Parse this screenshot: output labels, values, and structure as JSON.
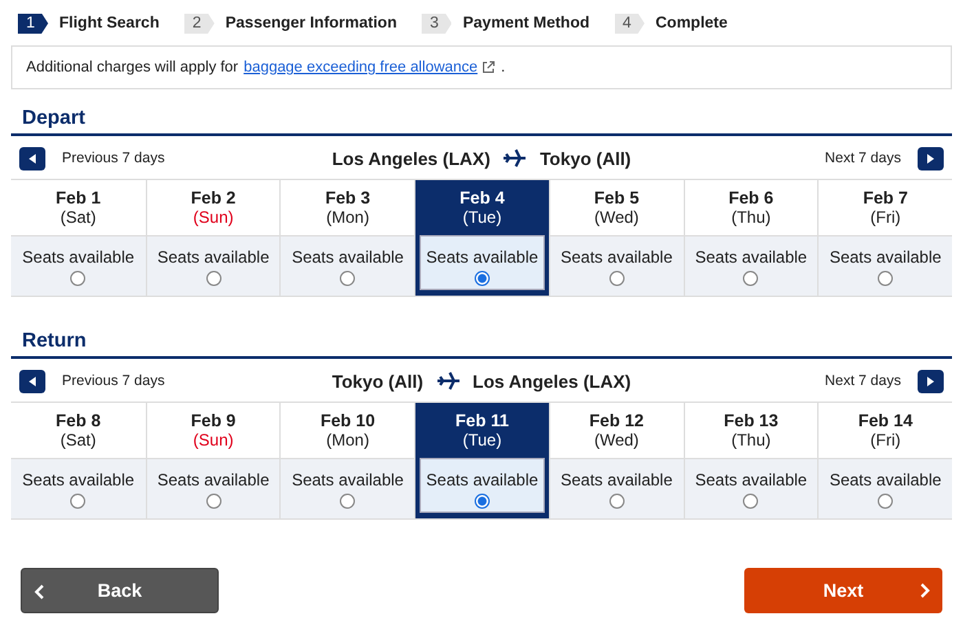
{
  "steps": [
    {
      "number": "1",
      "label": "Flight Search",
      "selected": true
    },
    {
      "number": "2",
      "label": "Passenger Information",
      "selected": false
    },
    {
      "number": "3",
      "label": "Payment Method",
      "selected": false
    },
    {
      "number": "4",
      "label": "Complete",
      "selected": false
    }
  ],
  "notice": {
    "text": "Additional charges will apply for",
    "link": "baggage exceeding free allowance",
    "after": "."
  },
  "sections": [
    {
      "title": "Depart",
      "previous": "Previous 7 days",
      "next": "Next 7 days",
      "origin": "Los Angeles (LAX)",
      "destination": "Tokyo (All)",
      "days": [
        {
          "date": "Feb 1",
          "weekday": "(Sat)",
          "sunday": false,
          "availability": "Seats available",
          "selected": false
        },
        {
          "date": "Feb 2",
          "weekday": "(Sun)",
          "sunday": true,
          "availability": "Seats available",
          "selected": false
        },
        {
          "date": "Feb 3",
          "weekday": "(Mon)",
          "sunday": false,
          "availability": "Seats available",
          "selected": false
        },
        {
          "date": "Feb 4",
          "weekday": "(Tue)",
          "sunday": false,
          "availability": "Seats available",
          "selected": true
        },
        {
          "date": "Feb 5",
          "weekday": "(Wed)",
          "sunday": false,
          "availability": "Seats available",
          "selected": false
        },
        {
          "date": "Feb 6",
          "weekday": "(Thu)",
          "sunday": false,
          "availability": "Seats available",
          "selected": false
        },
        {
          "date": "Feb 7",
          "weekday": "(Fri)",
          "sunday": false,
          "availability": "Seats available",
          "selected": false
        }
      ]
    },
    {
      "title": "Return",
      "previous": "Previous 7 days",
      "next": "Next 7 days",
      "origin": "Tokyo (All)",
      "destination": "Los Angeles (LAX)",
      "days": [
        {
          "date": "Feb 8",
          "weekday": "(Sat)",
          "sunday": false,
          "availability": "Seats available",
          "selected": false
        },
        {
          "date": "Feb 9",
          "weekday": "(Sun)",
          "sunday": true,
          "availability": "Seats available",
          "selected": false
        },
        {
          "date": "Feb 10",
          "weekday": "(Mon)",
          "sunday": false,
          "availability": "Seats available",
          "selected": false
        },
        {
          "date": "Feb 11",
          "weekday": "(Tue)",
          "sunday": false,
          "availability": "Seats available",
          "selected": true
        },
        {
          "date": "Feb 12",
          "weekday": "(Wed)",
          "sunday": false,
          "availability": "Seats available",
          "selected": false
        },
        {
          "date": "Feb 13",
          "weekday": "(Thu)",
          "sunday": false,
          "availability": "Seats available",
          "selected": false
        },
        {
          "date": "Feb 14",
          "weekday": "(Fri)",
          "sunday": false,
          "availability": "Seats available",
          "selected": false
        }
      ]
    }
  ],
  "buttons": {
    "back": "Back",
    "next": "Next"
  }
}
